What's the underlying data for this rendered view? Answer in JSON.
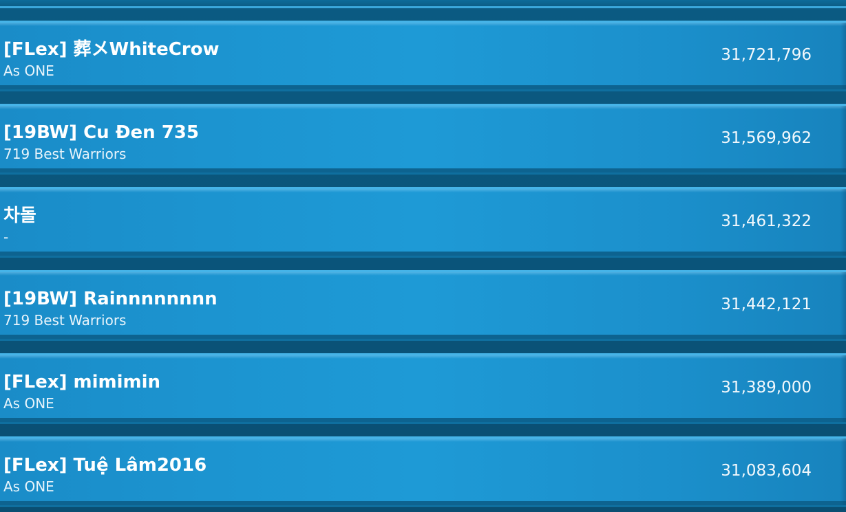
{
  "leaderboard": {
    "rows": [
      {
        "name": "[FLex] 葬メWhiteCrow",
        "guild": "As ONE",
        "score": "31,721,796"
      },
      {
        "name": "[19BW] Cu Đen 735",
        "guild": "719 Best Warriors",
        "score": "31,569,962"
      },
      {
        "name": "차돌",
        "guild": "-",
        "score": "31,461,322"
      },
      {
        "name": "[19BW] Rainnnnnnnn",
        "guild": "719 Best Warriors",
        "score": "31,442,121"
      },
      {
        "name": "[FLex] mimimin",
        "guild": "As ONE",
        "score": "31,389,000"
      },
      {
        "name": "[FLex] Tuệ Lâm2016",
        "guild": "As ONE",
        "score": "31,083,604"
      }
    ]
  }
}
